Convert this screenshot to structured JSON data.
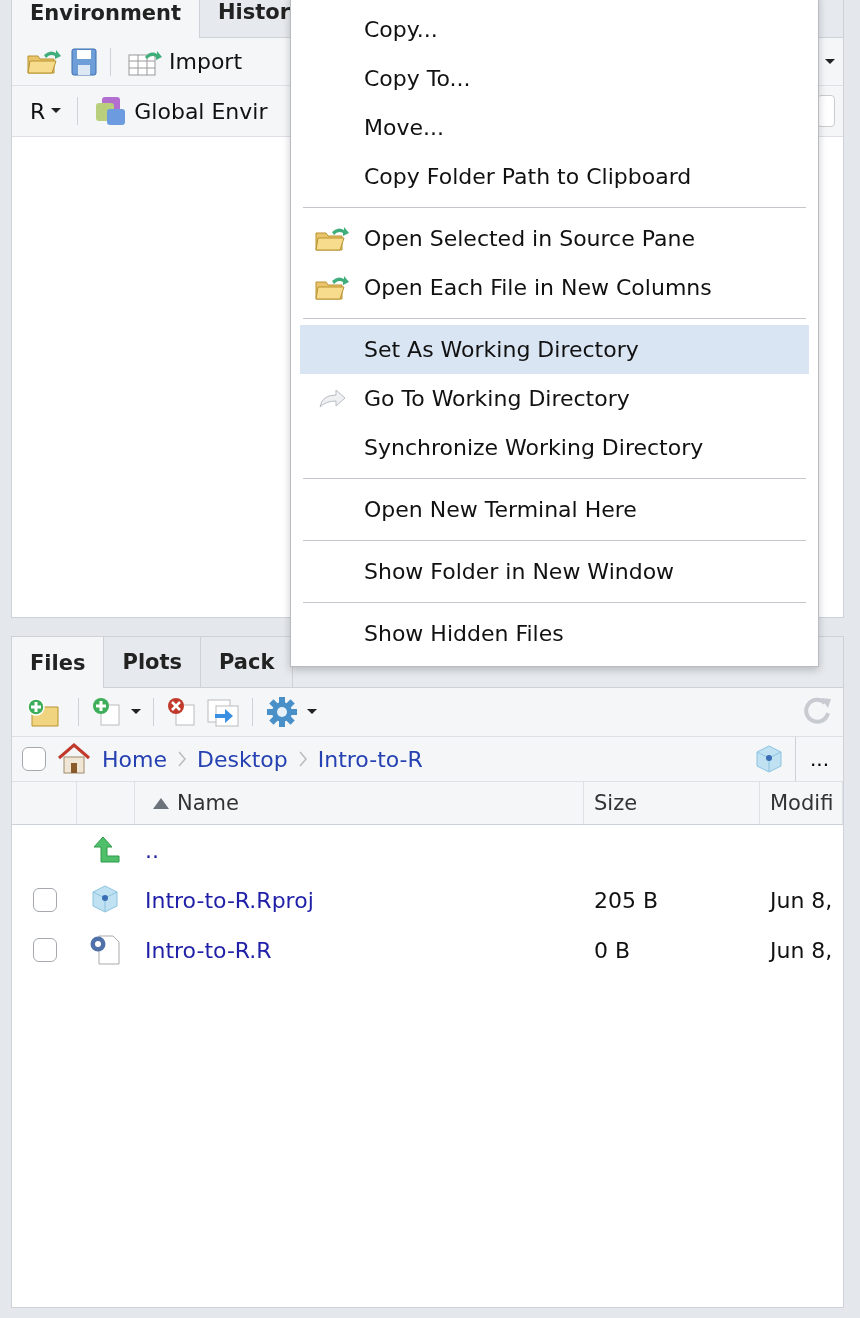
{
  "environment_pane": {
    "tabs": [
      {
        "label": "Environment",
        "selected": true
      },
      {
        "label": "Histor",
        "selected": false
      }
    ],
    "toolbar": {
      "import_label": "Import"
    },
    "scope_bar": {
      "language": "R",
      "environment": "Global Envir"
    }
  },
  "context_menu": {
    "groups": [
      [
        {
          "label": "Copy...",
          "selected": false
        },
        {
          "label": "Copy To...",
          "selected": false
        },
        {
          "label": "Move...",
          "selected": false
        },
        {
          "label": "Copy Folder Path to Clipboard",
          "selected": false
        }
      ],
      [
        {
          "label": "Open Selected in Source Pane",
          "kind": "open",
          "selected": false
        },
        {
          "label": "Open Each File in New Columns",
          "kind": "open",
          "selected": false
        }
      ],
      [
        {
          "label": "Set As Working Directory",
          "selected": true
        },
        {
          "label": "Go To Working Directory",
          "kind": "goto",
          "selected": false
        },
        {
          "label": "Synchronize Working Directory",
          "selected": false
        }
      ],
      [
        {
          "label": "Open New Terminal Here",
          "selected": false
        }
      ],
      [
        {
          "label": "Show Folder in New Window",
          "selected": false
        }
      ],
      [
        {
          "label": "Show Hidden Files",
          "selected": false
        }
      ]
    ]
  },
  "files_pane": {
    "tabs": [
      {
        "label": "Files",
        "selected": true
      },
      {
        "label": "Plots",
        "selected": false
      },
      {
        "label": "Pack",
        "selected": false
      }
    ],
    "all_selected": false,
    "breadcrumb": [
      "Home",
      "Desktop",
      "Intro-to-R"
    ],
    "more_label": "...",
    "columns": [
      "Name",
      "Size",
      "Modifi"
    ],
    "parent_link": "..",
    "rows": [
      {
        "name": "Intro-to-R.Rproj",
        "kind": "rproj",
        "size": "205 B",
        "modified": "Jun 8,",
        "checked": false
      },
      {
        "name": "Intro-to-R.R",
        "kind": "rscript",
        "size": "0 B",
        "modified": "Jun 8,",
        "checked": false
      }
    ]
  }
}
